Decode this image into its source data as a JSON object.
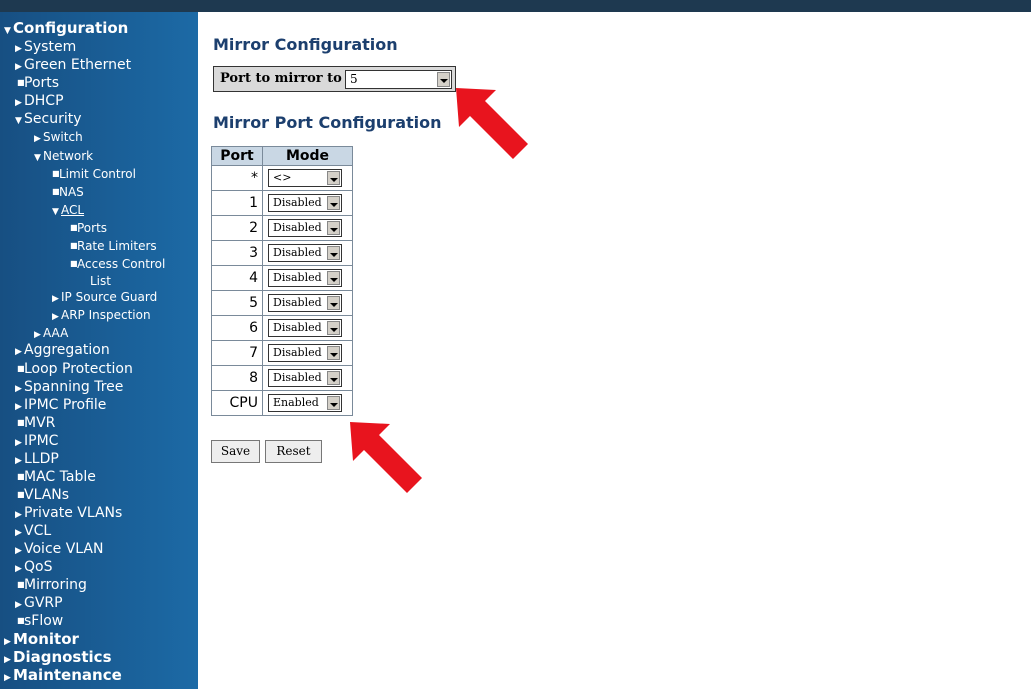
{
  "sidebar": {
    "items": [
      {
        "label": "Configuration",
        "marker": "down"
      },
      {
        "label": "System",
        "marker": "right"
      },
      {
        "label": "Green Ethernet",
        "marker": "right"
      },
      {
        "label": "Ports",
        "marker": "bullet"
      },
      {
        "label": "DHCP",
        "marker": "right"
      },
      {
        "label": "Security",
        "marker": "down"
      },
      {
        "label": "Switch",
        "marker": "right"
      },
      {
        "label": "Network",
        "marker": "down"
      },
      {
        "label": "Limit Control",
        "marker": "bullet"
      },
      {
        "label": "NAS",
        "marker": "bullet"
      },
      {
        "label": "ACL",
        "marker": "down"
      },
      {
        "label": "Ports",
        "marker": "bullet"
      },
      {
        "label": "Rate Limiters",
        "marker": "bullet"
      },
      {
        "label": "Access Control",
        "marker": "bullet"
      },
      {
        "label": "List",
        "marker": "none"
      },
      {
        "label": "IP Source Guard",
        "marker": "right"
      },
      {
        "label": "ARP Inspection",
        "marker": "right"
      },
      {
        "label": "AAA",
        "marker": "right"
      },
      {
        "label": "Aggregation",
        "marker": "right"
      },
      {
        "label": "Loop Protection",
        "marker": "bullet"
      },
      {
        "label": "Spanning Tree",
        "marker": "right"
      },
      {
        "label": "IPMC Profile",
        "marker": "right"
      },
      {
        "label": "MVR",
        "marker": "bullet"
      },
      {
        "label": "IPMC",
        "marker": "right"
      },
      {
        "label": "LLDP",
        "marker": "right"
      },
      {
        "label": "MAC Table",
        "marker": "bullet"
      },
      {
        "label": "VLANs",
        "marker": "bullet"
      },
      {
        "label": "Private VLANs",
        "marker": "right"
      },
      {
        "label": "VCL",
        "marker": "right"
      },
      {
        "label": "Voice VLAN",
        "marker": "right"
      },
      {
        "label": "QoS",
        "marker": "right"
      },
      {
        "label": "Mirroring",
        "marker": "bullet"
      },
      {
        "label": "GVRP",
        "marker": "right"
      },
      {
        "label": "sFlow",
        "marker": "bullet"
      },
      {
        "label": "Monitor",
        "marker": "right"
      },
      {
        "label": "Diagnostics",
        "marker": "right"
      },
      {
        "label": "Maintenance",
        "marker": "right"
      }
    ]
  },
  "main": {
    "title": "Mirror Configuration",
    "mirror_to_label": "Port to mirror to",
    "mirror_to_value": "5",
    "subtitle": "Mirror Port Configuration",
    "table": {
      "headers": [
        "Port",
        "Mode"
      ],
      "rows": [
        {
          "port": "*",
          "mode": "<>"
        },
        {
          "port": "1",
          "mode": "Disabled"
        },
        {
          "port": "2",
          "mode": "Disabled"
        },
        {
          "port": "3",
          "mode": "Disabled"
        },
        {
          "port": "4",
          "mode": "Disabled"
        },
        {
          "port": "5",
          "mode": "Disabled"
        },
        {
          "port": "6",
          "mode": "Disabled"
        },
        {
          "port": "7",
          "mode": "Disabled"
        },
        {
          "port": "8",
          "mode": "Disabled"
        },
        {
          "port": "CPU",
          "mode": "Enabled"
        }
      ]
    },
    "save_label": "Save",
    "reset_label": "Reset"
  },
  "colors": {
    "sidebar_start": "#174f82",
    "sidebar_end": "#1c6aa6",
    "title": "#1c3f6e",
    "table_header": "#c9d7e4",
    "arrow": "#e8141e"
  }
}
